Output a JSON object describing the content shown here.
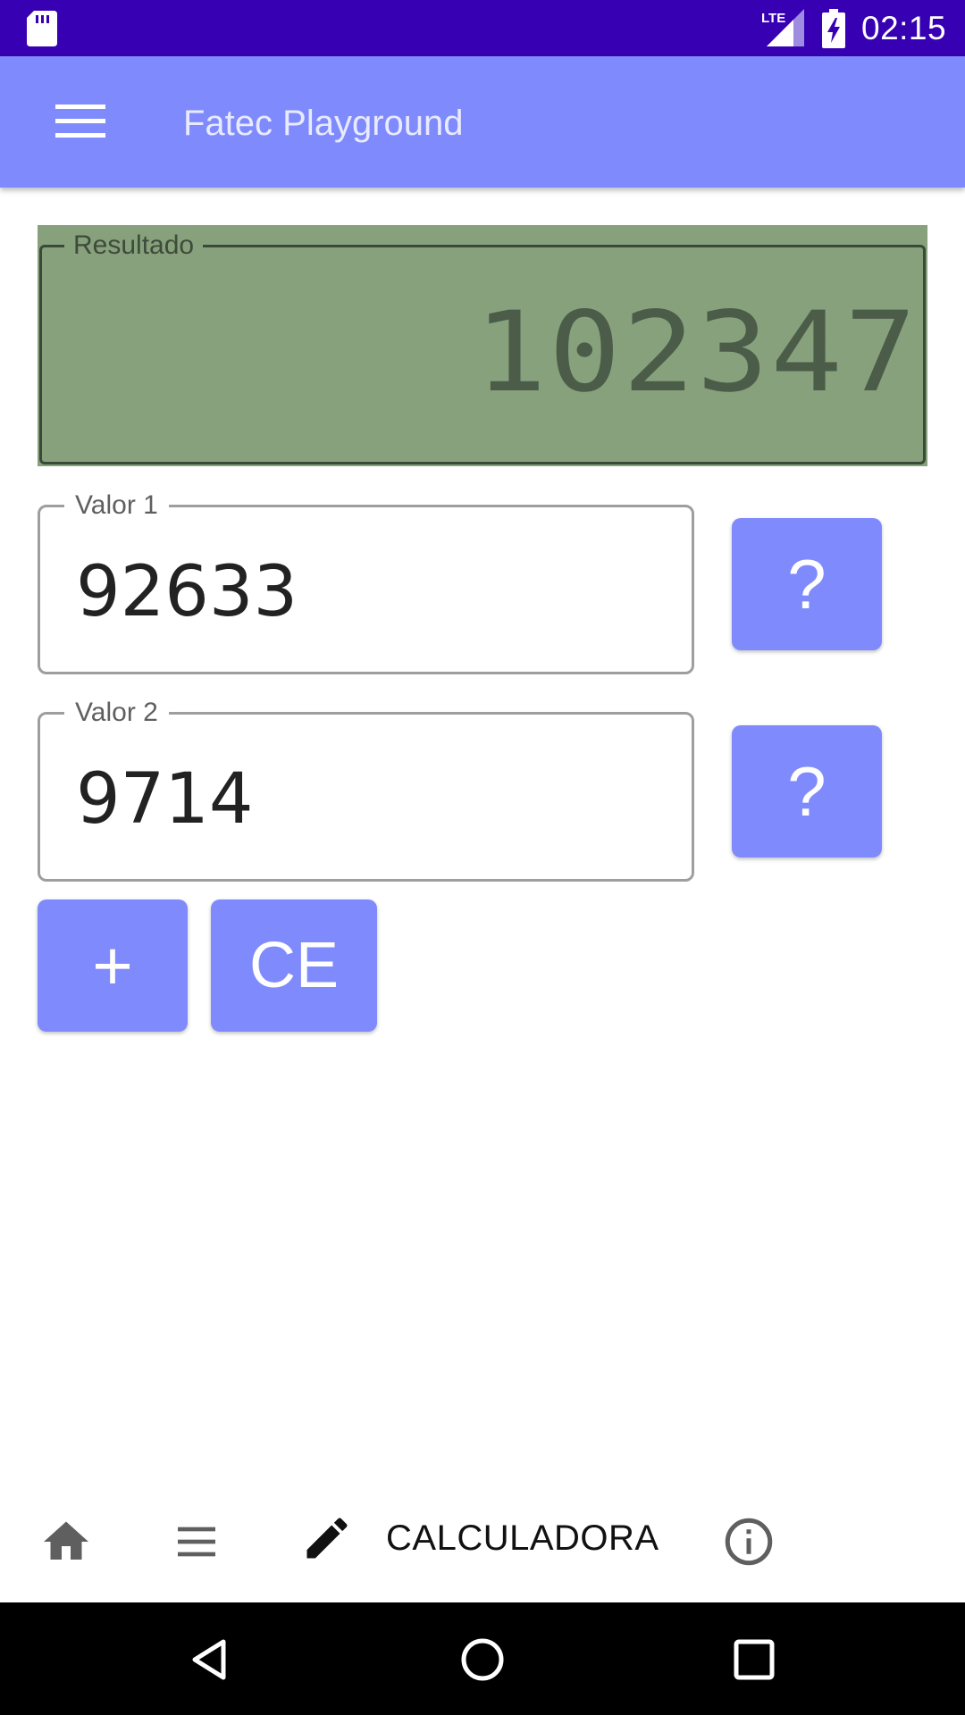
{
  "status_bar": {
    "time": "02:15",
    "network": "LTE",
    "icons": [
      "sd-card-icon",
      "lte-signal-icon",
      "battery-charging-icon"
    ]
  },
  "app_bar": {
    "title": "Fatec Playground",
    "menu_icon": "hamburger-menu-icon"
  },
  "result": {
    "label": "Resultado",
    "value": "102347"
  },
  "inputs": {
    "valor1": {
      "label": "Valor 1",
      "value": "92633"
    },
    "valor2": {
      "label": "Valor 2",
      "value": "9714"
    }
  },
  "buttons": {
    "help1": "?",
    "help2": "?",
    "add": "+",
    "clear": "CE"
  },
  "bottom_nav": {
    "items": [
      {
        "icon": "home-icon"
      },
      {
        "icon": "list-icon"
      },
      {
        "icon": "pencil-icon",
        "label": "CALCULADORA",
        "selected": true
      },
      {
        "icon": "info-icon"
      }
    ]
  },
  "system_nav": {
    "icons": [
      "back-icon",
      "home-circle-icon",
      "recents-icon"
    ]
  },
  "colors": {
    "status_bar": "#3700b3",
    "primary": "#7f8bfd",
    "display_bg": "#87a17c",
    "display_text": "#4b5c48"
  }
}
